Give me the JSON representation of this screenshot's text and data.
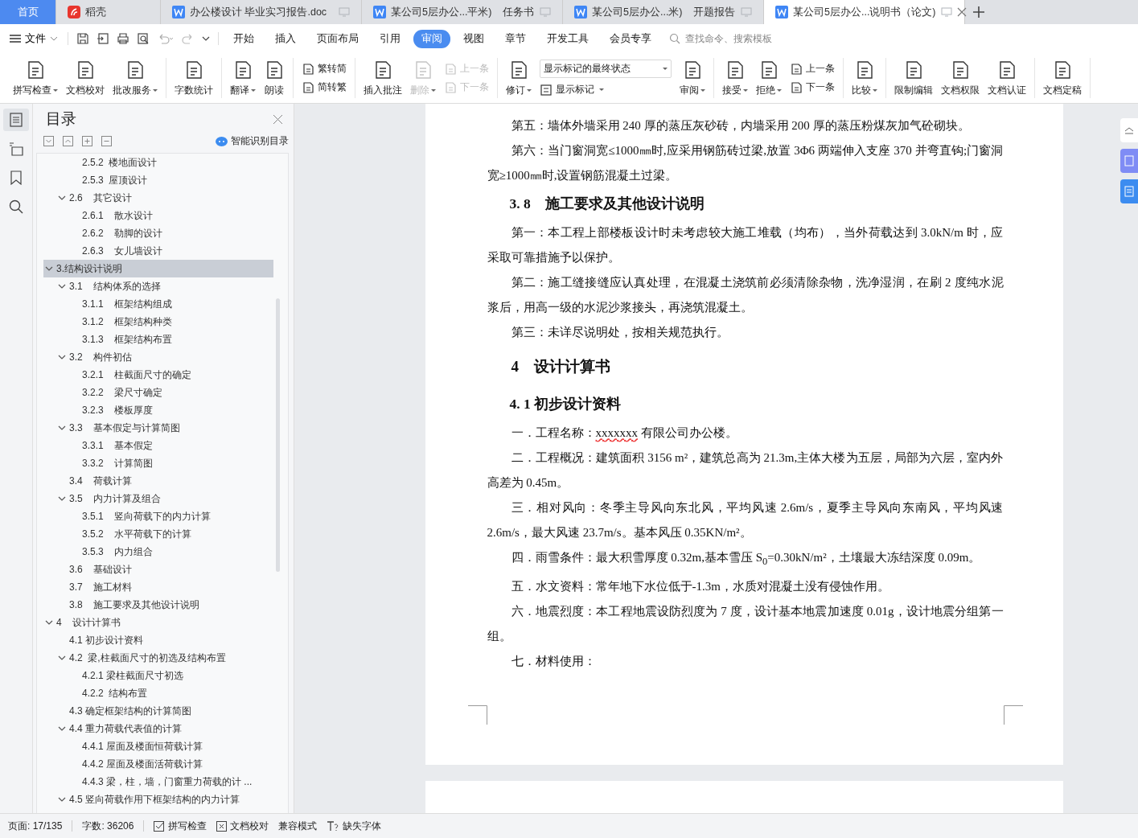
{
  "tabs": [
    {
      "kind": "home",
      "label": "首页",
      "selected": false
    },
    {
      "kind": "app",
      "label": "稻壳",
      "selected": false
    },
    {
      "kind": "doc",
      "label": "办公楼设计 毕业实习报告.doc",
      "selected": false
    },
    {
      "kind": "doc",
      "label": "某公司5层办公...平米)　任务书",
      "selected": false
    },
    {
      "kind": "doc",
      "label": "某公司5层办公...米)　开题报告",
      "selected": false
    },
    {
      "kind": "doc",
      "label": "某公司5层办公...说明书（论文)",
      "selected": true
    }
  ],
  "menu": {
    "file_label": "文件",
    "items": [
      {
        "label": "开始",
        "selected": false
      },
      {
        "label": "插入",
        "selected": false
      },
      {
        "label": "页面布局",
        "selected": false
      },
      {
        "label": "引用",
        "selected": false
      },
      {
        "label": "审阅",
        "selected": true
      },
      {
        "label": "视图",
        "selected": false
      },
      {
        "label": "章节",
        "selected": false
      },
      {
        "label": "开发工具",
        "selected": false
      },
      {
        "label": "会员专享",
        "selected": false
      }
    ],
    "search": {
      "placeholder": "查找命令、搜索模板"
    }
  },
  "ribbon": [
    {
      "items": [
        {
          "kind": "large",
          "label": "拼写检查",
          "dropdown": true,
          "disabled": false
        },
        {
          "kind": "large",
          "label": "文档校对",
          "dropdown": false,
          "disabled": false
        },
        {
          "kind": "large",
          "label": "批改服务",
          "dropdown": true,
          "disabled": false
        }
      ]
    },
    {
      "items": [
        {
          "kind": "large",
          "label": "字数统计",
          "dropdown": false,
          "disabled": false
        }
      ]
    },
    {
      "items": [
        {
          "kind": "large",
          "label": "翻译",
          "dropdown": true,
          "disabled": false
        },
        {
          "kind": "large",
          "label": "朗读",
          "dropdown": false,
          "disabled": false
        }
      ]
    },
    {
      "items": [
        {
          "kind": "stack",
          "items": [
            {
              "label": "繁转简",
              "dropdown": false,
              "disabled": false
            },
            {
              "label": "简转繁",
              "dropdown": false,
              "disabled": false
            }
          ]
        }
      ]
    },
    {
      "items": [
        {
          "kind": "large",
          "label": "插入批注",
          "dropdown": false,
          "disabled": false
        },
        {
          "kind": "large",
          "label": "删除",
          "dropdown": true,
          "disabled": true
        },
        {
          "kind": "stack",
          "items": [
            {
              "label": "上一条",
              "dropdown": false,
              "disabled": true
            },
            {
              "label": "下一条",
              "dropdown": false,
              "disabled": true
            }
          ]
        }
      ]
    },
    {
      "items": [
        {
          "kind": "large",
          "label": "修订",
          "dropdown": true,
          "disabled": false
        },
        {
          "kind": "select",
          "value": "显示标记的最终状态",
          "items": [
            {
              "label": "显示标记",
              "dropdown": true,
              "disabled": false
            }
          ]
        },
        {
          "kind": "large",
          "label": "审阅",
          "dropdown": true,
          "disabled": false
        }
      ]
    },
    {
      "items": [
        {
          "kind": "large",
          "label": "接受",
          "dropdown": true,
          "disabled": false
        },
        {
          "kind": "large",
          "label": "拒绝",
          "dropdown": true,
          "disabled": false
        },
        {
          "kind": "stack",
          "items": [
            {
              "label": "上一条",
              "dropdown": false,
              "disabled": false
            },
            {
              "label": "下一条",
              "dropdown": false,
              "disabled": false
            }
          ]
        }
      ]
    },
    {
      "items": [
        {
          "kind": "large",
          "label": "比较",
          "dropdown": true,
          "disabled": false
        }
      ]
    },
    {
      "items": [
        {
          "kind": "large",
          "label": "限制编辑",
          "dropdown": false,
          "disabled": false
        },
        {
          "kind": "large",
          "label": "文档权限",
          "dropdown": false,
          "disabled": false
        },
        {
          "kind": "large",
          "label": "文档认证",
          "dropdown": false,
          "disabled": false
        }
      ]
    },
    {
      "items": [
        {
          "kind": "large",
          "label": "文档定稿",
          "dropdown": false,
          "disabled": false
        }
      ]
    }
  ],
  "toc": {
    "title": "目录",
    "smart_button": "智能识别目录",
    "items": [
      {
        "children": [
          {
            "children": [
              {
                "label": "2.5.2  楼地面设计"
              },
              {
                "label": "2.5.3  屋顶设计"
              }
            ]
          },
          {
            "label": "2.6    其它设计",
            "expanded": true,
            "selected": false,
            "children": [
              {
                "label": "2.6.1    散水设计"
              },
              {
                "label": "2.6.2    勒脚的设计"
              },
              {
                "label": "2.6.3    女儿墙设计"
              }
            ]
          }
        ]
      },
      {
        "label": "3.结构设计说明",
        "expanded": true,
        "selected": true,
        "children": [
          {
            "label": "3.1    结构体系的选择",
            "expanded": true,
            "selected": false,
            "children": [
              {
                "label": "3.1.1    框架结构组成"
              },
              {
                "label": "3.1.2    框架结构种类"
              },
              {
                "label": "3.1.3    框架结构布置"
              }
            ]
          },
          {
            "label": "3.2    构件初估",
            "expanded": true,
            "selected": false,
            "children": [
              {
                "label": "3.2.1    柱截面尺寸的确定"
              },
              {
                "label": "3.2.2    梁尺寸确定"
              },
              {
                "label": "3.2.3    楼板厚度"
              }
            ]
          },
          {
            "label": "3.3    基本假定与计算简图",
            "expanded": true,
            "selected": false,
            "children": [
              {
                "label": "3.3.1    基本假定"
              },
              {
                "label": "3.3.2    计算简图"
              }
            ]
          },
          {
            "label": "3.4    荷载计算"
          },
          {
            "label": "3.5    内力计算及组合",
            "expanded": true,
            "selected": false,
            "children": [
              {
                "label": "3.5.1    竖向荷载下的内力计算"
              },
              {
                "label": "3.5.2    水平荷载下的计算"
              },
              {
                "label": "3.5.3    内力组合"
              }
            ]
          },
          {
            "label": "3.6    基础设计"
          },
          {
            "label": "3.7    施工材料"
          },
          {
            "label": "3.8    施工要求及其他设计说明"
          }
        ]
      },
      {
        "label": "4    设计计算书",
        "expanded": true,
        "selected": false,
        "children": [
          {
            "label": "4.1 初步设计资料"
          },
          {
            "label": "4.2  梁,柱截面尺寸的初选及结构布置",
            "expanded": true,
            "selected": false,
            "children": [
              {
                "label": "4.2.1 梁柱截面尺寸初选"
              },
              {
                "label": "4.2.2  结构布置"
              }
            ]
          },
          {
            "label": "4.3 确定框架结构的计算简图"
          },
          {
            "label": "4.4 重力荷载代表值的计算",
            "expanded": true,
            "selected": false,
            "children": [
              {
                "label": "4.4.1 屋面及楼面恒荷载计算"
              },
              {
                "label": "4.4.2 屋面及楼面活荷载计算"
              },
              {
                "label": "4.4.3 梁，柱，墙，门窗重力荷载的计 ..."
              }
            ]
          },
          {
            "label": "4.5 竖向荷载作用下框架结构的内力计算",
            "expanded": true,
            "selected": false
          }
        ]
      }
    ]
  },
  "document": [
    {
      "kind": "para",
      "text": "第五：墙体外墙采用 240 厚的蒸压灰砂砖，内墙采用 200 厚的蒸压粉煤灰加气砼砌块。"
    },
    {
      "kind": "para",
      "text": "第六：当门窗洞宽≤1000㎜时,应采用钢筋砖过梁,放置 3Φ6 两端伸入支座 370 并弯直钩;门窗洞宽≥1000㎜时,设置钢筋混凝土过梁。"
    },
    {
      "kind": "heading2",
      "text": "3. 8　施工要求及其他设计说明"
    },
    {
      "kind": "para",
      "text": "第一：本工程上部楼板设计时未考虑较大施工堆载（均布），当外荷载达到 3.0kN/m 时，应采取可靠措施予以保护。"
    },
    {
      "kind": "para",
      "text": "第二：施工缝接缝应认真处理，在混凝土浇筑前必须清除杂物，洗净湿润，在刷 2 度纯水泥浆后，用高一级的水泥沙浆接头，再浇筑混凝土。"
    },
    {
      "kind": "para",
      "text": "第三：未详尽说明处，按相关规范执行。"
    },
    {
      "kind": "heading1",
      "text": "4　设计计算书"
    },
    {
      "kind": "heading2",
      "text": "4. 1 初步设计资料"
    },
    {
      "kind": "parts",
      "parts": [
        {
          "text": "一．工程名称：",
          "misspelled": false
        },
        {
          "text": "xxxxxxx",
          "misspelled": true
        },
        {
          "text": " 有限公司办公楼。",
          "misspelled": false
        }
      ]
    },
    {
      "kind": "para",
      "text": "二．工程概况：建筑面积 3156 m²，建筑总高为 21.3m,主体大楼为五层，局部为六层，室内外高差为 0.45m。"
    },
    {
      "kind": "para",
      "text": "三．相对风向：冬季主导风向东北风，平均风速 2.6m/s，夏季主导风向东南风，平均风速 2.6m/s，最大风速 23.7m/s。基本风压 0.35KN/m²。"
    },
    {
      "kind": "para",
      "text": "四．雨雪条件：最大积雪厚度 0.32m,基本雪压 S$_{0}$=0.30kN/m²，土壤最大冻结深度 0.09m。"
    },
    {
      "kind": "para",
      "text": "五．水文资料：常年地下水位低于-1.3m，水质对混凝土没有侵蚀作用。"
    },
    {
      "kind": "para",
      "text": "六．地震烈度：本工程地震设防烈度为 7 度，设计基本地震加速度 0.01g，设计地震分组第一组。"
    },
    {
      "kind": "para",
      "text": "七．材料使用："
    }
  ],
  "status_bar": {
    "page": "页面: 17/135",
    "words": "字数: 36206",
    "spell_check": "拼写检查",
    "proofread": "文档校对",
    "mode": "兼容模式",
    "missing_fonts": "缺失字体"
  }
}
